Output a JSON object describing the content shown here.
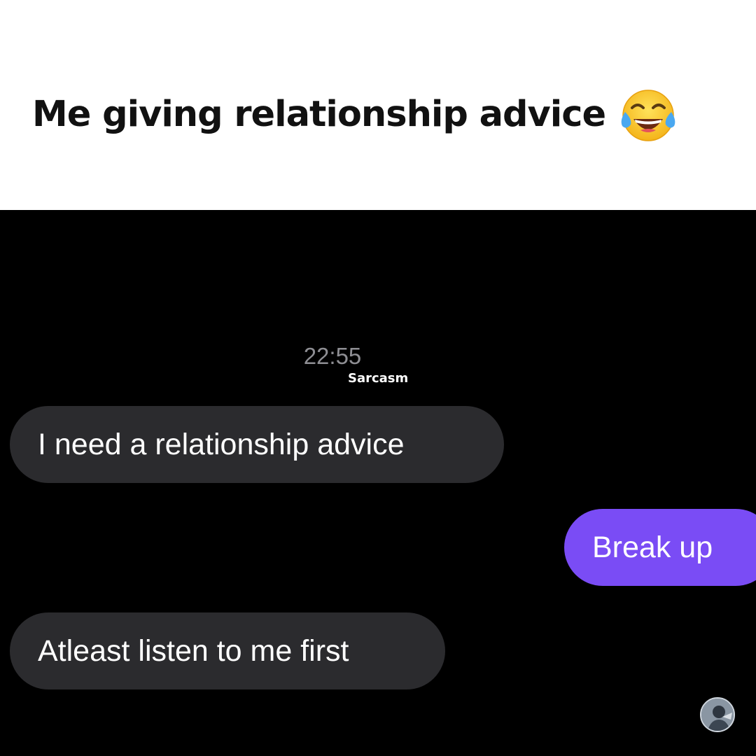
{
  "caption": {
    "text": "Me giving relationship advice",
    "emoji": "face-with-tears-of-joy-icon"
  },
  "chat": {
    "timestamp": "22:55",
    "watermark": "Sarcasm",
    "messages": [
      {
        "side": "received",
        "text": "I need a relationship advice"
      },
      {
        "side": "sent",
        "text": "Break up"
      },
      {
        "side": "received",
        "text": "Atleast listen to me first"
      }
    ],
    "avatar_icon": "profile-avatar-icon"
  },
  "colors": {
    "sent_bubble": "#7a4cf5",
    "received_bubble": "#2b2b2e",
    "chat_background": "#000000",
    "timestamp": "#8e8e93"
  }
}
